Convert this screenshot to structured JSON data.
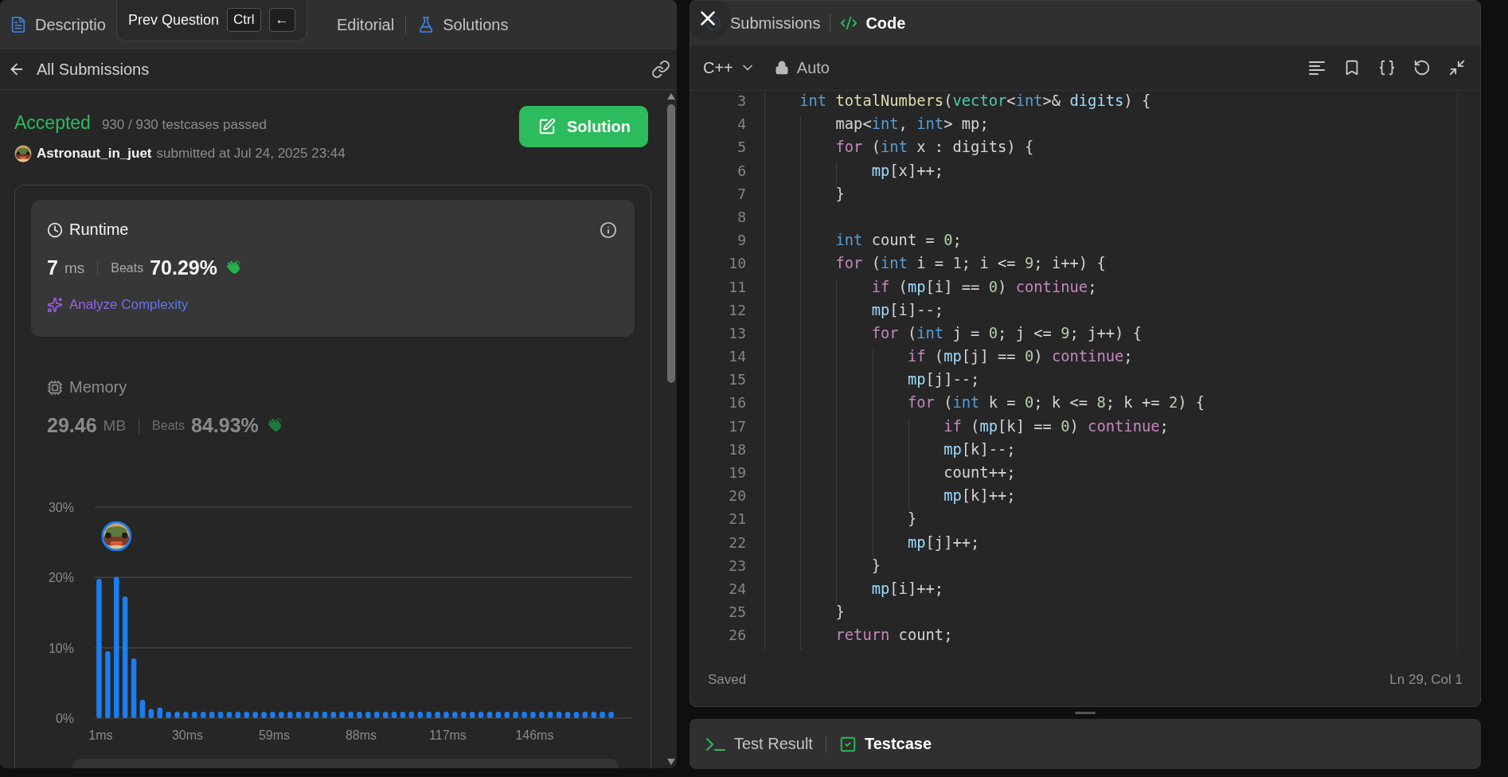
{
  "left_panel": {
    "tabs": [
      {
        "label": "Descriptio",
        "kind": "description",
        "selected": false
      },
      {
        "label": "Editorial",
        "kind": "editorial",
        "selected": false
      },
      {
        "label": "Solutions",
        "kind": "solutions",
        "selected": false
      }
    ],
    "tooltip": {
      "label": "Prev Question",
      "keys": [
        "Ctrl",
        "←"
      ]
    },
    "header": {
      "back_label": "All Submissions"
    },
    "submission": {
      "status": "Accepted",
      "testcases": "930 / 930 testcases passed",
      "author": "Astronaut_in_juet",
      "submitted": "submitted at Jul 24, 2025 23:44",
      "solution_button": "Solution"
    },
    "metrics": [
      {
        "kind": "runtime",
        "title": "Runtime",
        "value": "7",
        "unit": "ms",
        "beats_label": "Beats",
        "beats": "70.29%",
        "selected": true,
        "action": "Analyze Complexity"
      },
      {
        "kind": "memory",
        "title": "Memory",
        "value": "29.46",
        "unit": "MB",
        "beats_label": "Beats",
        "beats": "84.93%",
        "selected": false
      }
    ],
    "chart_data": {
      "type": "bar",
      "categories": [
        "1ms",
        null,
        null,
        null,
        null,
        null,
        null,
        null,
        null,
        null,
        "30ms",
        null,
        null,
        null,
        null,
        null,
        null,
        null,
        null,
        null,
        "59ms",
        null,
        null,
        null,
        null,
        null,
        null,
        null,
        null,
        null,
        "88ms",
        null,
        null,
        null,
        null,
        null,
        null,
        null,
        null,
        null,
        "117ms",
        null,
        null,
        null,
        null,
        null,
        null,
        null,
        null,
        null,
        "146ms",
        null,
        null,
        null,
        null,
        null,
        null,
        null,
        null,
        null
      ],
      "values": [
        19.8,
        9.5,
        20.1,
        17.3,
        8.5,
        2.6,
        1.3,
        1.5,
        0.9,
        0.9,
        0.9,
        0.9,
        0.9,
        0.9,
        0.9,
        0.9,
        0.9,
        0.9,
        0.9,
        0.9,
        0.9,
        0.9,
        0.9,
        0.9,
        0.9,
        0.9,
        0.9,
        0.9,
        0.9,
        0.9,
        0.9,
        0.9,
        0.9,
        0.9,
        0.9,
        0.9,
        0.9,
        0.9,
        0.9,
        0.9,
        0.9,
        0.9,
        0.9,
        0.9,
        0.9,
        0.9,
        0.9,
        0.9,
        0.9,
        0.9,
        0.9,
        0.9,
        0.9,
        0.9,
        0.9,
        0.9,
        0.9,
        0.9,
        0.9,
        0.9
      ],
      "ylim": [
        0,
        30
      ],
      "yticks": [
        {
          "value": 0,
          "label": "0%"
        },
        {
          "value": 10,
          "label": "10%"
        },
        {
          "value": 20,
          "label": "20%"
        },
        {
          "value": 30,
          "label": "30%"
        }
      ],
      "ylabel": null
    }
  },
  "editor": {
    "tabs": [
      {
        "label": "Submissions",
        "kind": "history",
        "selected": false
      },
      {
        "label": "Code",
        "kind": "code",
        "selected": true
      }
    ],
    "language": "C++",
    "mode": "Auto",
    "lines": [
      {
        "number": "3",
        "tokens": [
          {
            "kind": "type",
            "text": "    int"
          },
          {
            "kind": "function",
            "text": " totalNumbers"
          },
          {
            "kind": "plain",
            "text": "("
          },
          {
            "kind": "class",
            "text": "vector"
          },
          {
            "kind": "plain",
            "text": "<"
          },
          {
            "kind": "type",
            "text": "int"
          },
          {
            "kind": "plain",
            "text": ">& "
          },
          {
            "kind": "variable",
            "text": "digits"
          },
          {
            "kind": "plain",
            "text": ") {"
          }
        ]
      },
      {
        "number": "4",
        "tokens": [
          {
            "kind": "plain",
            "text": "        map<"
          },
          {
            "kind": "type",
            "text": "int"
          },
          {
            "kind": "plain",
            "text": ", "
          },
          {
            "kind": "type",
            "text": "int"
          },
          {
            "kind": "plain",
            "text": "> mp;"
          }
        ]
      },
      {
        "number": "5",
        "tokens": [
          {
            "kind": "keyword",
            "text": "        for"
          },
          {
            "kind": "plain",
            "text": " ("
          },
          {
            "kind": "type",
            "text": "int"
          },
          {
            "kind": "plain",
            "text": " x : digits) {"
          }
        ]
      },
      {
        "number": "6",
        "tokens": [
          {
            "kind": "variable",
            "text": "            mp"
          },
          {
            "kind": "plain",
            "text": "[x]++;"
          }
        ]
      },
      {
        "number": "7",
        "tokens": [
          {
            "kind": "plain",
            "text": "        }"
          }
        ]
      },
      {
        "number": "8"
      },
      {
        "number": "9",
        "tokens": [
          {
            "kind": "type",
            "text": "        int"
          },
          {
            "kind": "plain",
            "text": " count = "
          },
          {
            "kind": "number",
            "text": "0"
          },
          {
            "kind": "plain",
            "text": ";"
          }
        ]
      },
      {
        "number": "10",
        "tokens": [
          {
            "kind": "keyword",
            "text": "        for"
          },
          {
            "kind": "plain",
            "text": " ("
          },
          {
            "kind": "type",
            "text": "int"
          },
          {
            "kind": "plain",
            "text": " i = "
          },
          {
            "kind": "number",
            "text": "1"
          },
          {
            "kind": "plain",
            "text": "; i <= "
          },
          {
            "kind": "number",
            "text": "9"
          },
          {
            "kind": "plain",
            "text": "; i++) {"
          }
        ]
      },
      {
        "number": "11",
        "tokens": [
          {
            "kind": "keyword",
            "text": "            if"
          },
          {
            "kind": "plain",
            "text": " ("
          },
          {
            "kind": "variable",
            "text": "mp"
          },
          {
            "kind": "plain",
            "text": "[i] == "
          },
          {
            "kind": "number",
            "text": "0"
          },
          {
            "kind": "plain",
            "text": ") "
          },
          {
            "kind": "keyword",
            "text": "continue"
          },
          {
            "kind": "plain",
            "text": ";"
          }
        ]
      },
      {
        "number": "12",
        "tokens": [
          {
            "kind": "variable",
            "text": "            mp"
          },
          {
            "kind": "plain",
            "text": "[i]--;"
          }
        ]
      },
      {
        "number": "13",
        "tokens": [
          {
            "kind": "keyword",
            "text": "            for"
          },
          {
            "kind": "plain",
            "text": " ("
          },
          {
            "kind": "type",
            "text": "int"
          },
          {
            "kind": "plain",
            "text": " j = "
          },
          {
            "kind": "number",
            "text": "0"
          },
          {
            "kind": "plain",
            "text": "; j <= "
          },
          {
            "kind": "number",
            "text": "9"
          },
          {
            "kind": "plain",
            "text": "; j++) {"
          }
        ]
      },
      {
        "number": "14",
        "tokens": [
          {
            "kind": "keyword",
            "text": "                if"
          },
          {
            "kind": "plain",
            "text": " ("
          },
          {
            "kind": "variable",
            "text": "mp"
          },
          {
            "kind": "plain",
            "text": "[j] == "
          },
          {
            "kind": "number",
            "text": "0"
          },
          {
            "kind": "plain",
            "text": ") "
          },
          {
            "kind": "keyword",
            "text": "continue"
          },
          {
            "kind": "plain",
            "text": ";"
          }
        ]
      },
      {
        "number": "15",
        "tokens": [
          {
            "kind": "variable",
            "text": "                mp"
          },
          {
            "kind": "plain",
            "text": "[j]--;"
          }
        ]
      },
      {
        "number": "16",
        "tokens": [
          {
            "kind": "keyword",
            "text": "                for"
          },
          {
            "kind": "plain",
            "text": " ("
          },
          {
            "kind": "type",
            "text": "int"
          },
          {
            "kind": "plain",
            "text": " k = "
          },
          {
            "kind": "number",
            "text": "0"
          },
          {
            "kind": "plain",
            "text": "; k <= "
          },
          {
            "kind": "number",
            "text": "8"
          },
          {
            "kind": "plain",
            "text": "; k += "
          },
          {
            "kind": "number",
            "text": "2"
          },
          {
            "kind": "plain",
            "text": ") {"
          }
        ]
      },
      {
        "number": "17",
        "tokens": [
          {
            "kind": "keyword",
            "text": "                    if"
          },
          {
            "kind": "plain",
            "text": " ("
          },
          {
            "kind": "variable",
            "text": "mp"
          },
          {
            "kind": "plain",
            "text": "[k] == "
          },
          {
            "kind": "number",
            "text": "0"
          },
          {
            "kind": "plain",
            "text": ") "
          },
          {
            "kind": "keyword",
            "text": "continue"
          },
          {
            "kind": "plain",
            "text": ";"
          }
        ]
      },
      {
        "number": "18",
        "tokens": [
          {
            "kind": "variable",
            "text": "                    mp"
          },
          {
            "kind": "plain",
            "text": "[k]--;"
          }
        ]
      },
      {
        "number": "19",
        "tokens": [
          {
            "kind": "plain",
            "text": "                    count++;"
          }
        ]
      },
      {
        "number": "20",
        "tokens": [
          {
            "kind": "variable",
            "text": "                    mp"
          },
          {
            "kind": "plain",
            "text": "[k]++;"
          }
        ]
      },
      {
        "number": "21",
        "tokens": [
          {
            "kind": "plain",
            "text": "                }"
          }
        ]
      },
      {
        "number": "22",
        "tokens": [
          {
            "kind": "variable",
            "text": "                mp"
          },
          {
            "kind": "plain",
            "text": "[j]++;"
          }
        ]
      },
      {
        "number": "23",
        "tokens": [
          {
            "kind": "plain",
            "text": "            }"
          }
        ]
      },
      {
        "number": "24",
        "tokens": [
          {
            "kind": "variable",
            "text": "            mp"
          },
          {
            "kind": "plain",
            "text": "[i]++;"
          }
        ]
      },
      {
        "number": "25",
        "tokens": [
          {
            "kind": "plain",
            "text": "        }"
          }
        ]
      },
      {
        "number": "26",
        "tokens": [
          {
            "kind": "keyword",
            "text": "        return"
          },
          {
            "kind": "plain",
            "text": " count;"
          }
        ]
      }
    ],
    "status": "Saved",
    "cursor": "Ln 29, Col 1"
  },
  "bottom_panel": {
    "tabs": [
      {
        "label": "Test Result",
        "kind": "terminal",
        "selected": false
      },
      {
        "label": "Testcase",
        "kind": "testcase",
        "selected": true
      }
    ]
  }
}
